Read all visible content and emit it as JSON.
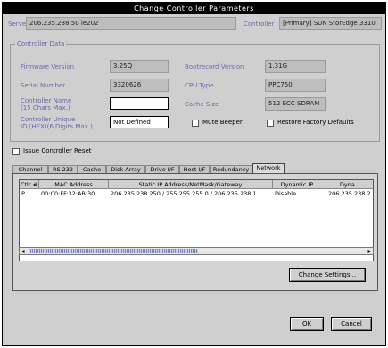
{
  "window": {
    "title": "Change Controller Parameters"
  },
  "top": {
    "server_label": "Server",
    "server_value": "206.235.238.50 ie202",
    "controller_label": "Controller",
    "controller_value": "[Primary] SUN StorEdge 3310"
  },
  "controller_data": {
    "group_title": "Controller Data",
    "firmware_label": "Firmware Version",
    "firmware_value": "3.25Q",
    "bootrecord_label": "Bootrecord Version",
    "bootrecord_value": "1.31G",
    "serial_label": "Serial Number",
    "serial_value": "3320626",
    "cpu_label": "CPU Type",
    "cpu_value": "PPC750",
    "name_label": "Controller Name",
    "name_label2": "(15 Chars Max.)",
    "name_value": "",
    "cache_label": "Cache Size",
    "cache_value": "512 ECC SDRAM",
    "uid_label": "Controller Unique",
    "uid_label2": "ID (HEX)(6 Digits Max.)",
    "uid_value": "Not Defined",
    "mute_beeper": "Mute Beeper",
    "restore_defaults": "Restore Factory Defaults"
  },
  "issue_reset": "Issue Controller Reset",
  "tabs": [
    {
      "label": "Channel"
    },
    {
      "label": "RS 232"
    },
    {
      "label": "Cache"
    },
    {
      "label": "Disk Array"
    },
    {
      "label": "Drive I/F"
    },
    {
      "label": "Host I/F"
    },
    {
      "label": "Redundancy"
    },
    {
      "label": "Network"
    }
  ],
  "network_table": {
    "columns": [
      "Ctlr #",
      "MAC Address",
      "Static IP Address/NetMask/Gateway",
      "Dynamic IP...",
      "Dyna..."
    ],
    "rows": [
      [
        "P",
        "00:C0:FF:32:AB:30",
        "206.235.238.250 / 255.255.255.0 / 206.235.238.1",
        "Disable",
        "206.235.238.2..."
      ]
    ]
  },
  "buttons": {
    "change_settings": "Change Settings...",
    "ok": "OK",
    "cancel": "Cancel"
  },
  "scrollbar": {
    "left_arrow": "◂",
    "right_arrow": "▸"
  }
}
